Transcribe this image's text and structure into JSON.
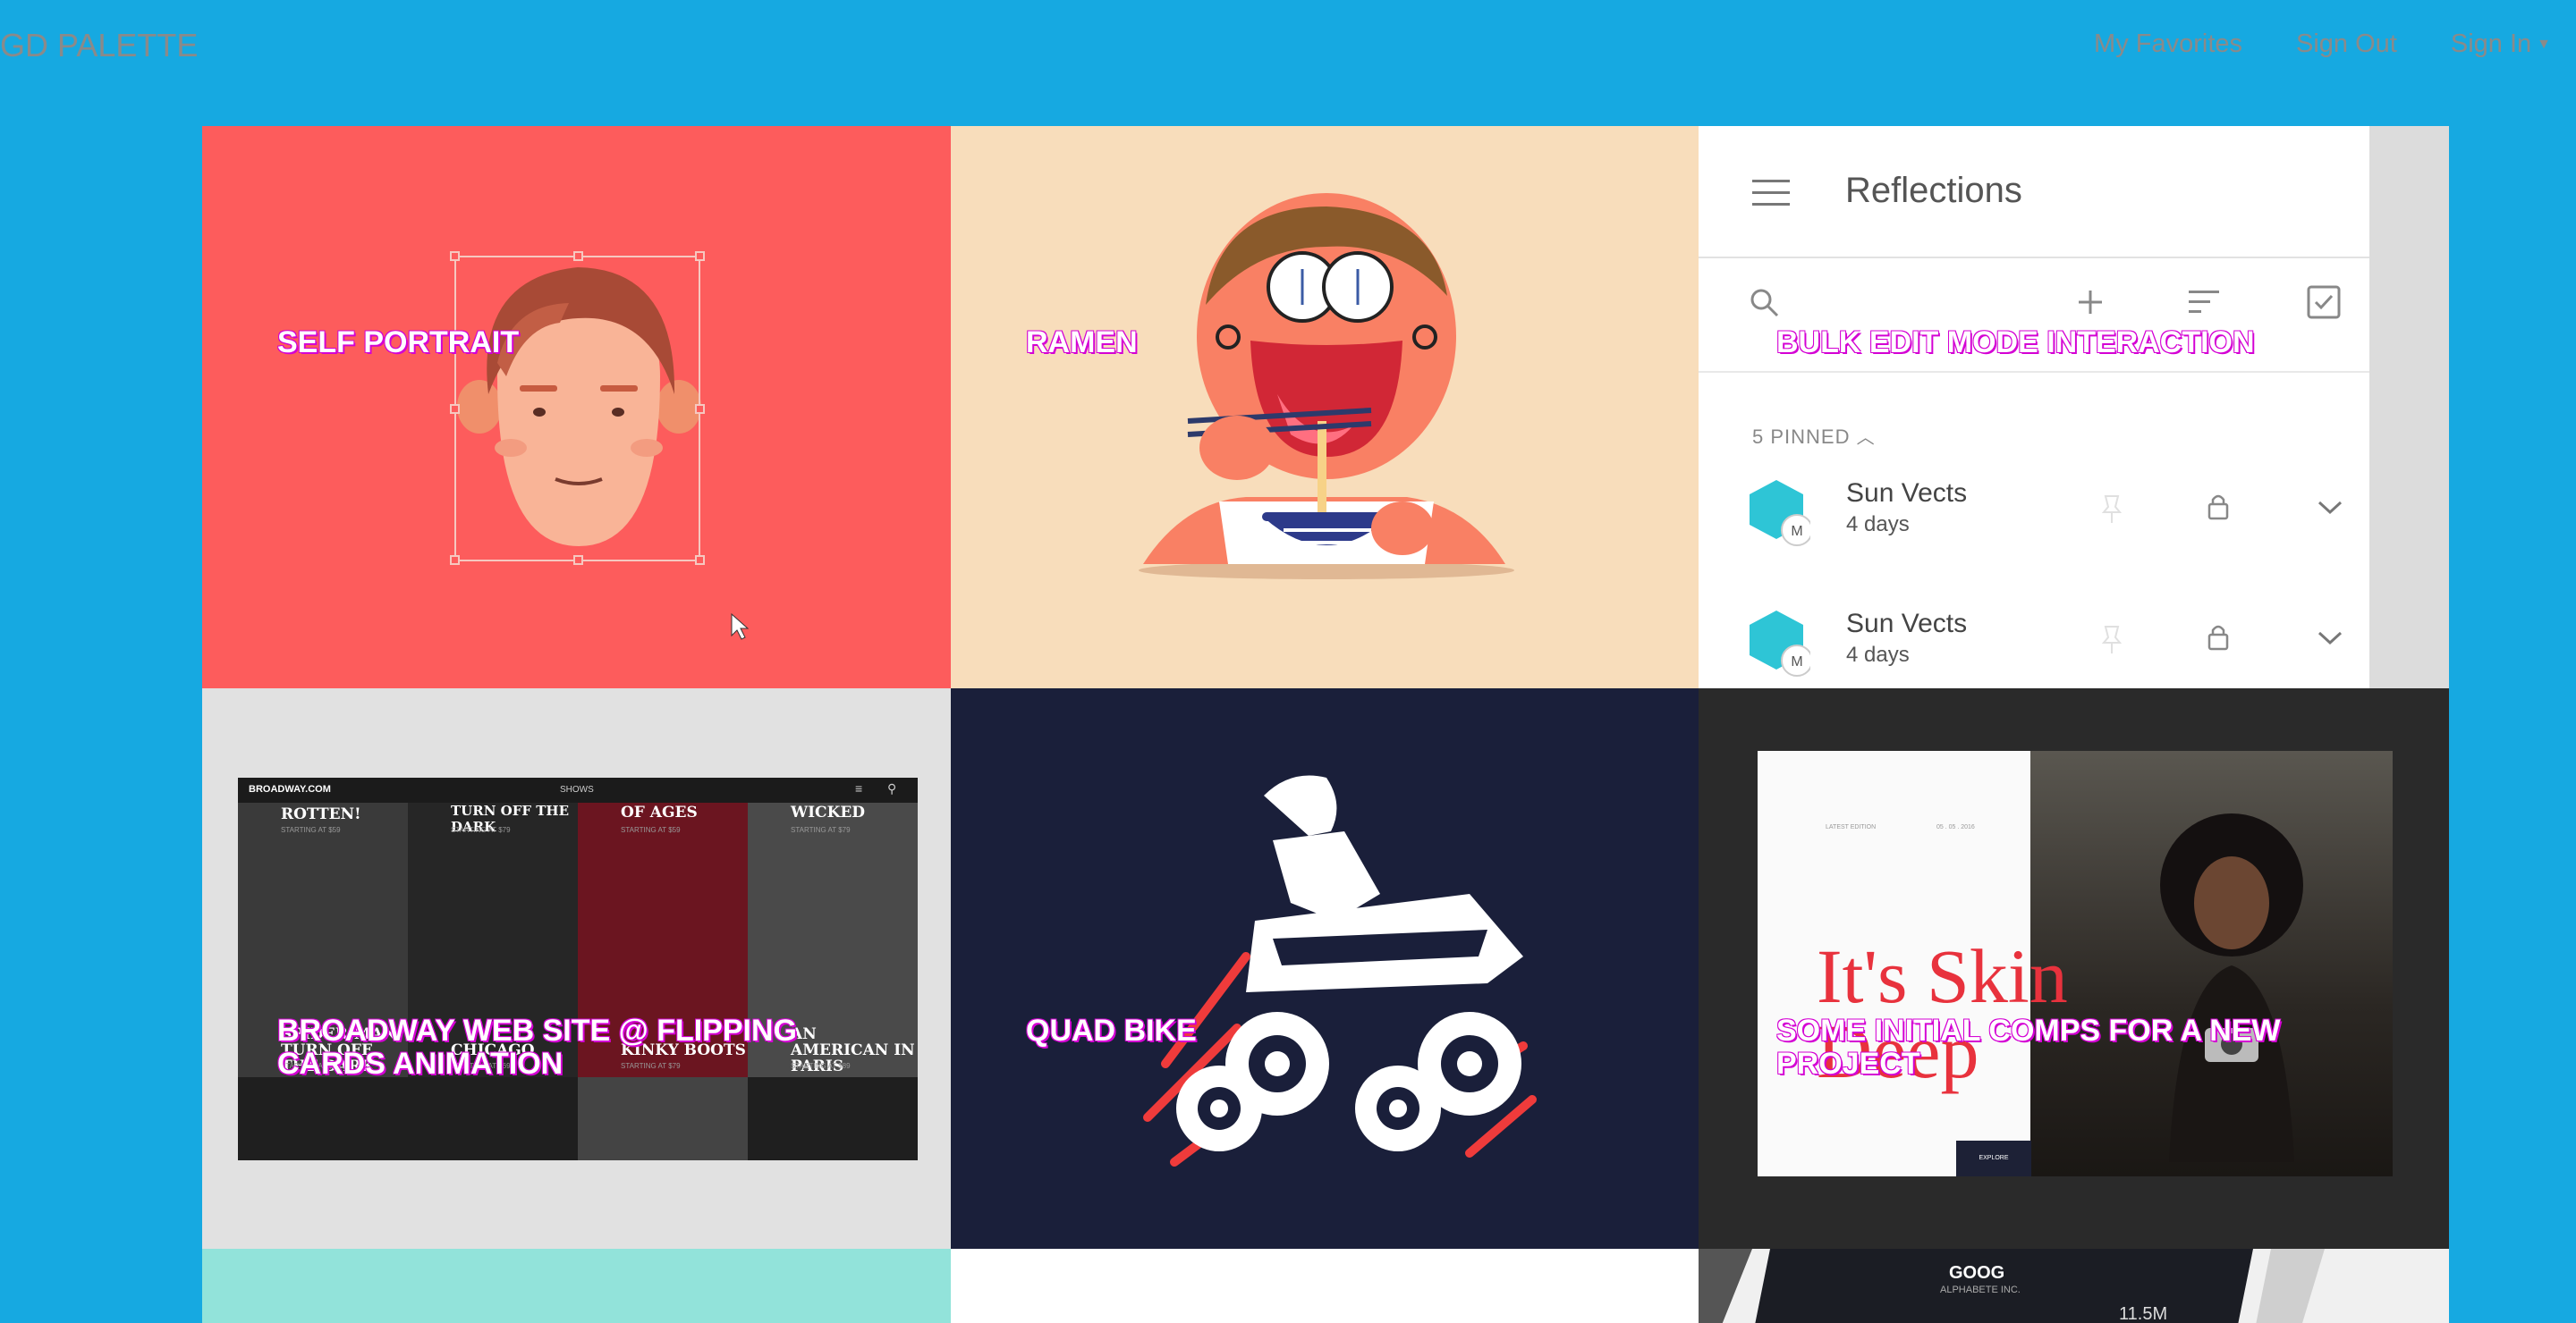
{
  "header": {
    "brand": "GD PALETTE",
    "nav": {
      "favorites": "My Favorites",
      "sign_out": "Sign Out",
      "sign_in": "Sign In"
    }
  },
  "shots": [
    {
      "title": "SELF PORTRAIT"
    },
    {
      "title": "RAMEN"
    },
    {
      "title": "BULK EDIT MODE INTERACTION"
    },
    {
      "title": "BROADWAY WEB SITE @ FLIPPING CARDS ANIMATION"
    },
    {
      "title": "QUAD BIKE"
    },
    {
      "title": "SOME INITIAL COMPS FOR A NEW PROJECT"
    }
  ],
  "reflections_mock": {
    "title": "Reflections",
    "pinned_label": "5 PINNED",
    "rows": [
      {
        "name": "Sun Vects",
        "sub": "4 days",
        "avatar": "M"
      },
      {
        "name": "Sun Vects",
        "sub": "4 days",
        "avatar": "M"
      }
    ]
  },
  "broadway_mock": {
    "logo": "BROADWAY.COM",
    "nav_label": "SHOWS",
    "tiles": [
      {
        "label": "ROTTEN!",
        "sub": "STARTING AT $59"
      },
      {
        "label": "TURN OFF THE DARK",
        "sub": "STARTING AT $79"
      },
      {
        "label": "OF AGES",
        "sub": "STARTING AT $59"
      },
      {
        "label": "WICKED",
        "sub": "STARTING AT $79"
      },
      {
        "label": "SPIDER-MAN, TURN OFF THE DARK",
        "sub": "STARTING AT $59"
      },
      {
        "label": "CHICAGO",
        "sub": "STARTING AT $69"
      },
      {
        "label": "KINKY BOOTS",
        "sub": "STARTING AT $79"
      },
      {
        "label": "AN AMERICAN IN PARIS",
        "sub": "STARTING AT $89"
      }
    ]
  },
  "magazine_mock": {
    "headline": "It's Skin Deep",
    "edition": "LATEST EDITION",
    "date": "05 . 05 . 2016",
    "button": "EXPLORE"
  },
  "stock_mock": {
    "ticker": "GOOG",
    "company": "ALPHABETE INC.",
    "value": "11.5M"
  },
  "colors": {
    "page_bg": "#16a9e1",
    "title_outline": "#d400d4"
  }
}
